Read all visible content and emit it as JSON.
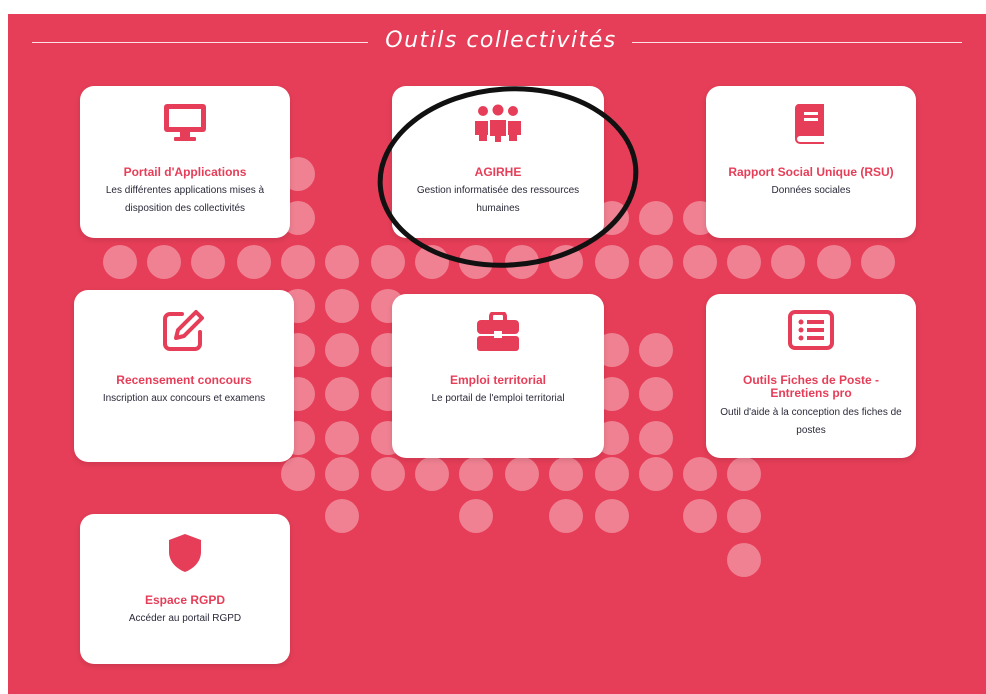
{
  "header": {
    "title": "Outils collectivités"
  },
  "cards": [
    {
      "title": "Portail d'Applications",
      "desc": "Les différentes applications mises à disposition des collectivités",
      "icon": "monitor-icon"
    },
    {
      "title": "AGIRHE",
      "desc": "Gestion informatisée des ressources humaines",
      "icon": "people-group-icon"
    },
    {
      "title": "Rapport Social Unique (RSU)",
      "desc": "Données sociales",
      "icon": "book-icon"
    },
    {
      "title": "Recensement concours",
      "desc": "Inscription aux concours et examens",
      "icon": "edit-icon"
    },
    {
      "title": "Emploi territorial",
      "desc": "Le portail de l'emploi territorial",
      "icon": "briefcase-icon"
    },
    {
      "title": "Outils Fiches de Poste - Entretiens pro",
      "desc": "Outil d'aide à la conception des fiches de postes",
      "icon": "list-icon"
    },
    {
      "title": "Espace RGPD",
      "desc": "Accéder au portail RGPD",
      "icon": "shield-icon"
    }
  ],
  "colors": {
    "accent": "#e63e58",
    "card": "#ffffff",
    "text": "#2a2a3a"
  }
}
